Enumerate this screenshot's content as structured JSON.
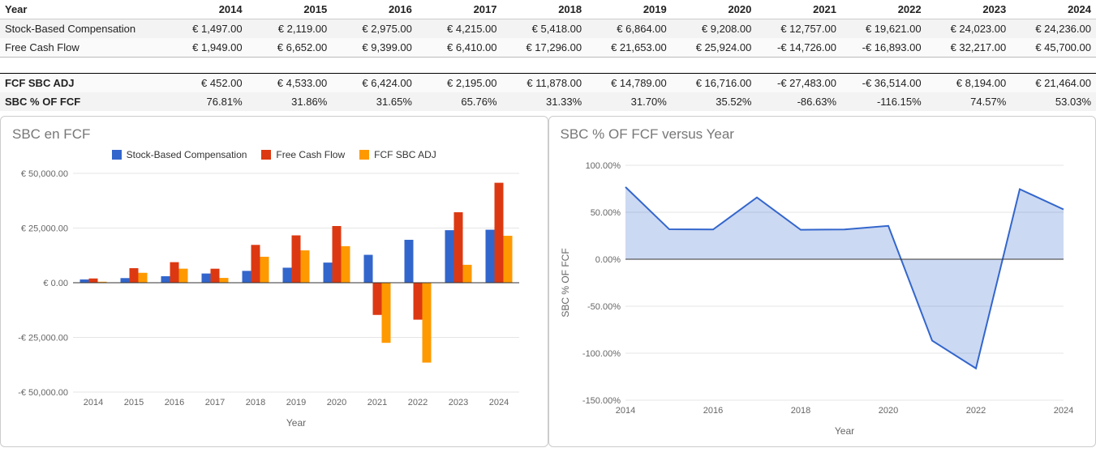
{
  "table": {
    "header": [
      "Year",
      "2014",
      "2015",
      "2016",
      "2017",
      "2018",
      "2019",
      "2020",
      "2021",
      "2022",
      "2023",
      "2024"
    ],
    "rows": [
      {
        "label": "Stock-Based Compensation",
        "cells": [
          "€ 1,497.00",
          "€ 2,119.00",
          "€ 2,975.00",
          "€ 4,215.00",
          "€ 5,418.00",
          "€ 6,864.00",
          "€ 9,208.00",
          "€ 12,757.00",
          "€ 19,621.00",
          "€ 24,023.00",
          "€ 24,236.00"
        ]
      },
      {
        "label": "Free Cash Flow",
        "cells": [
          "€ 1,949.00",
          "€ 6,652.00",
          "€ 9,399.00",
          "€ 6,410.00",
          "€ 17,296.00",
          "€ 21,653.00",
          "€ 25,924.00",
          "-€ 14,726.00",
          "-€ 16,893.00",
          "€ 32,217.00",
          "€ 45,700.00"
        ]
      }
    ],
    "summary": [
      {
        "label": "FCF SBC ADJ",
        "cells": [
          "€ 452.00",
          "€ 4,533.00",
          "€ 6,424.00",
          "€ 2,195.00",
          "€ 11,878.00",
          "€ 14,789.00",
          "€ 16,716.00",
          "-€ 27,483.00",
          "-€ 36,514.00",
          "€ 8,194.00",
          "€ 21,464.00"
        ]
      },
      {
        "label": "SBC % OF FCF",
        "cells": [
          "76.81%",
          "31.86%",
          "31.65%",
          "65.76%",
          "31.33%",
          "31.70%",
          "35.52%",
          "-86.63%",
          "-116.15%",
          "74.57%",
          "53.03%"
        ]
      }
    ]
  },
  "chart_data": [
    {
      "type": "bar",
      "title": "SBC en FCF",
      "xlabel": "Year",
      "ylabel": "",
      "ylim": [
        -50000,
        50000
      ],
      "yticks": [
        "€ 50,000.00",
        "€ 25,000.00",
        "€ 0.00",
        "-€ 25,000.00",
        "-€ 50,000.00"
      ],
      "categories": [
        "2014",
        "2015",
        "2016",
        "2017",
        "2018",
        "2019",
        "2020",
        "2021",
        "2022",
        "2023",
        "2024"
      ],
      "series": [
        {
          "name": "Stock-Based Compensation",
          "color": "#3366cc",
          "values": [
            1497,
            2119,
            2975,
            4215,
            5418,
            6864,
            9208,
            12757,
            19621,
            24023,
            24236
          ]
        },
        {
          "name": "Free Cash Flow",
          "color": "#dc3912",
          "values": [
            1949,
            6652,
            9399,
            6410,
            17296,
            21653,
            25924,
            -14726,
            -16893,
            32217,
            45700
          ]
        },
        {
          "name": "FCF SBC ADJ",
          "color": "#ff9900",
          "values": [
            452,
            4533,
            6424,
            2195,
            11878,
            14789,
            16716,
            -27483,
            -36514,
            8194,
            21464
          ]
        }
      ]
    },
    {
      "type": "area",
      "title": "SBC % OF FCF versus Year",
      "xlabel": "Year",
      "ylabel": "SBC % OF FCF",
      "ylim": [
        -150,
        100
      ],
      "yticks": [
        "100.00%",
        "50.00%",
        "0.00%",
        "-50.00%",
        "-100.00%",
        "-150.00%"
      ],
      "xticks": [
        "2014",
        "2016",
        "2018",
        "2020",
        "2022",
        "2024"
      ],
      "x": [
        2014,
        2015,
        2016,
        2017,
        2018,
        2019,
        2020,
        2021,
        2022,
        2023,
        2024
      ],
      "series": [
        {
          "name": "SBC % OF FCF",
          "color": "#3366cc",
          "values": [
            76.81,
            31.86,
            31.65,
            65.76,
            31.33,
            31.7,
            35.52,
            -86.63,
            -116.15,
            74.57,
            53.03
          ]
        }
      ]
    }
  ]
}
